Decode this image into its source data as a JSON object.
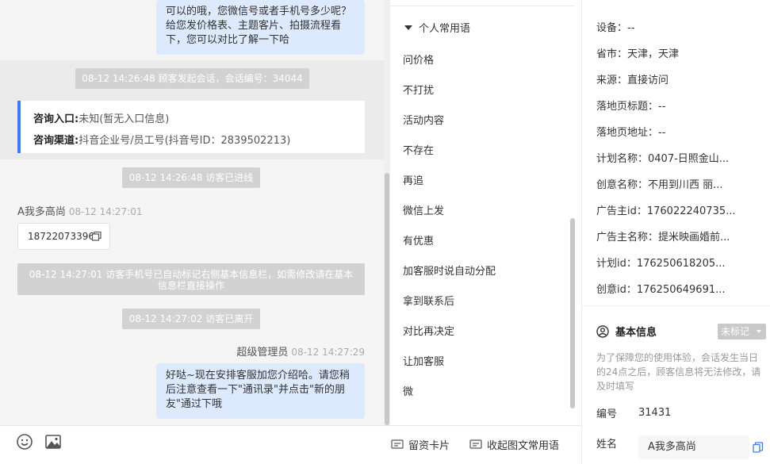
{
  "chat": {
    "msg_top": "可以的哦，您微信号或者手机号多少呢？给您发价格表、主题客片、拍摄流程看下，您可以对比了解一下哈",
    "sys_start": "08-12 14:26:48 顾客发起会话，会话编号：34044",
    "consult_entry_label": "咨询入口:",
    "consult_entry_value": "未知(暂无入口信息)",
    "consult_channel_label": "咨询渠道:",
    "consult_channel_value": "抖音企业号/员工号(抖音号ID：2839502213)",
    "sys_enter": "08-12 14:26:48 访客已进线",
    "visitor_name": "A我多高尚",
    "visitor_time": "08-12 14:27:01",
    "visitor_phone": "18722073396",
    "sys_phone_marked": "08-12 14:27:01 访客手机号已自动标记右侧基本信息栏，如需修改请在基本信息栏直接操作",
    "sys_leave": "08-12 14:27:02 访客已离开",
    "agent_name": "超级管理员",
    "agent_time": "08-12 14:27:29",
    "msg_bottom": "好哒~现在安排客服加您介绍哈。请您稍后注意查看一下\"通讯录\"并点击\"新的朋友\"通过下哦"
  },
  "input_bar": {
    "card_label": "留资卡片",
    "collect_label": "收起图文常用语"
  },
  "phrases": {
    "header": "个人常用语",
    "items": [
      "问价格",
      "不打扰",
      "活动内容",
      "不存在",
      "再追",
      "微信上发",
      "有优惠",
      "加客服时说自动分配",
      "拿到联系后",
      "对比再决定",
      "让加客服",
      "微"
    ]
  },
  "source_info": {
    "rows": [
      "设备：--",
      "省市：天津，天津",
      "来源：直接访问",
      "落地页标题：--",
      "落地页地址：--",
      "计划名称：0407-日照金山...",
      "创意名称：不用到川西 丽...",
      "广告主id：176022240735...",
      "广告主名称：提米映画婚前...",
      "计划id：176250618205...",
      "创意id：176250649691..."
    ]
  },
  "basic_info": {
    "title": "基本信息",
    "tag": "未标记",
    "notice": "为了保障您的使用体验，会话发生当日的24点之后，顾客信息将无法修改，请及时填写",
    "no_label": "编号",
    "no_value": "31431",
    "name_label": "姓名",
    "name_value": "A我多高尚"
  },
  "colors": {
    "accent": "#3b7bf6",
    "bubble": "#dde9fc",
    "pill": "#d2d2d2"
  }
}
